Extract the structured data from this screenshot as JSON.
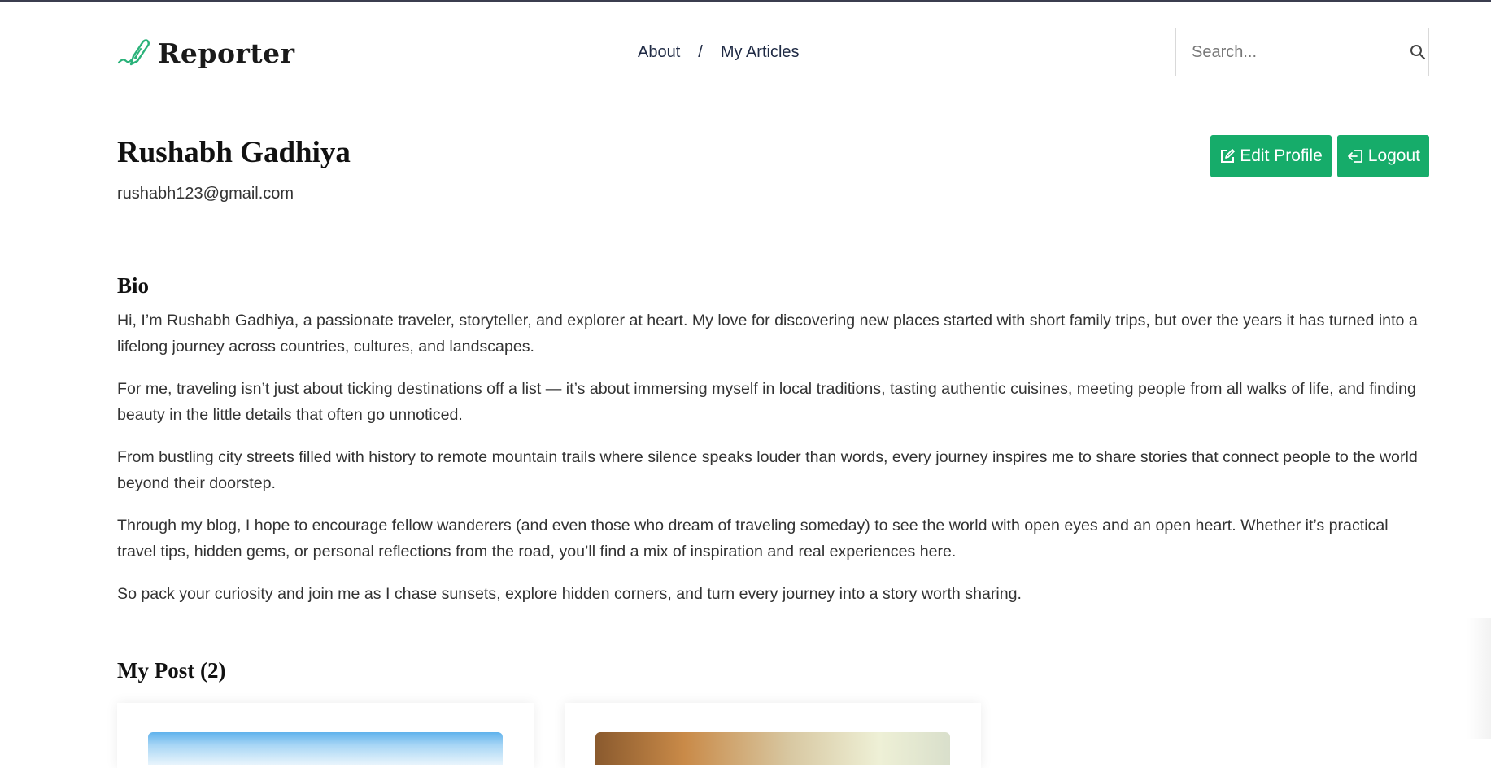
{
  "header": {
    "logo_text": "Reporter",
    "nav": [
      {
        "label": "About"
      },
      {
        "label": "My Articles"
      }
    ],
    "nav_separator": "/",
    "search": {
      "placeholder": "Search...",
      "value": ""
    }
  },
  "profile": {
    "name": "Rushabh Gadhiya",
    "email": "rushabh123@gmail.com",
    "edit_label": "Edit Profile",
    "logout_label": "Logout"
  },
  "bio": {
    "title": "Bio",
    "paragraphs": [
      "Hi, I’m Rushabh Gadhiya, a passionate traveler, storyteller, and explorer at heart. My love for discovering new places started with short family trips, but over the years it has turned into a lifelong journey across countries, cultures, and landscapes.",
      "For me, traveling isn’t just about ticking destinations off a list — it’s about immersing myself in local traditions, tasting authentic cuisines, meeting people from all walks of life, and finding beauty in the little details that often go unnoticed.",
      "From bustling city streets filled with history to remote mountain trails where silence speaks louder than words, every journey inspires me to share stories that connect people to the world beyond their doorstep.",
      "Through my blog, I hope to encourage fellow wanderers (and even those who dream of traveling someday) to see the world with open eyes and an open heart. Whether it’s practical travel tips, hidden gems, or personal reflections from the road, you’ll find a mix of inspiration and real experiences here.",
      "So pack your curiosity and join me as I chase sunsets, explore hidden corners, and turn every journey into a story worth sharing."
    ]
  },
  "posts": {
    "title": "My Post (2)"
  },
  "colors": {
    "accent": "#16ac6a",
    "nav_text": "#1f2a44"
  },
  "icons": {
    "logo": "quill-pen-icon",
    "search": "search-icon",
    "edit": "edit-icon",
    "logout": "logout-icon"
  }
}
